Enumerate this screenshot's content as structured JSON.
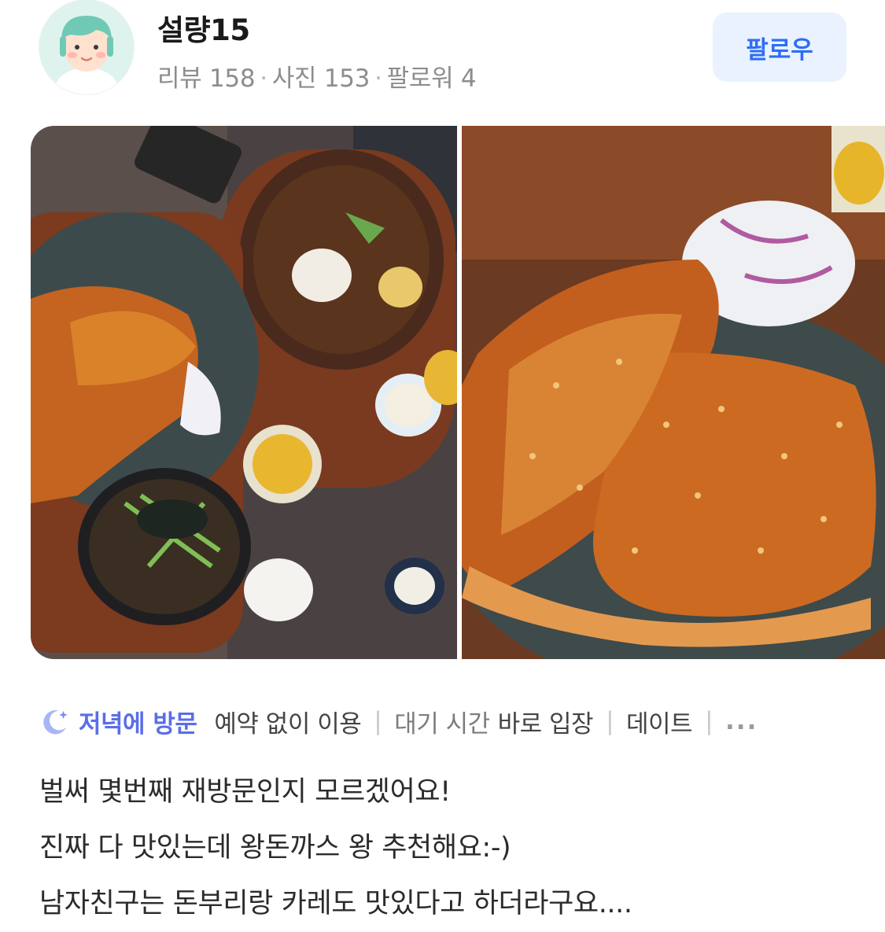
{
  "profile": {
    "username": "설량15",
    "review_count": "리뷰 158",
    "photo_count": "사진 153",
    "follower_count": "팔로워 4",
    "avatar_icon": "user-avatar-illustration"
  },
  "follow_button": {
    "label": "팔로우",
    "bg": "#eaf2ff",
    "color": "#2f6df6"
  },
  "photos": [
    {
      "icon": "food-photo-tonkatsu-set"
    },
    {
      "icon": "food-photo-tonkatsu-closeup"
    }
  ],
  "visit_tags": {
    "time_icon": "moon-star-icon",
    "time_label": "저녁에 방문",
    "items": [
      {
        "value": "예약 없이 이용"
      },
      {
        "key": "대기 시간",
        "value": "바로 입장"
      },
      {
        "value": "데이트"
      }
    ],
    "more": "...",
    "accent": "#5a6ee8"
  },
  "review": {
    "lines": [
      "벌써 몇번째 재방문인지 모르겠어요!",
      "진짜 다 맛있는데 왕돈까스 왕 추천해요:-)",
      "남자친구는 돈부리랑 카레도 맛있다고 하더라구요...."
    ]
  }
}
